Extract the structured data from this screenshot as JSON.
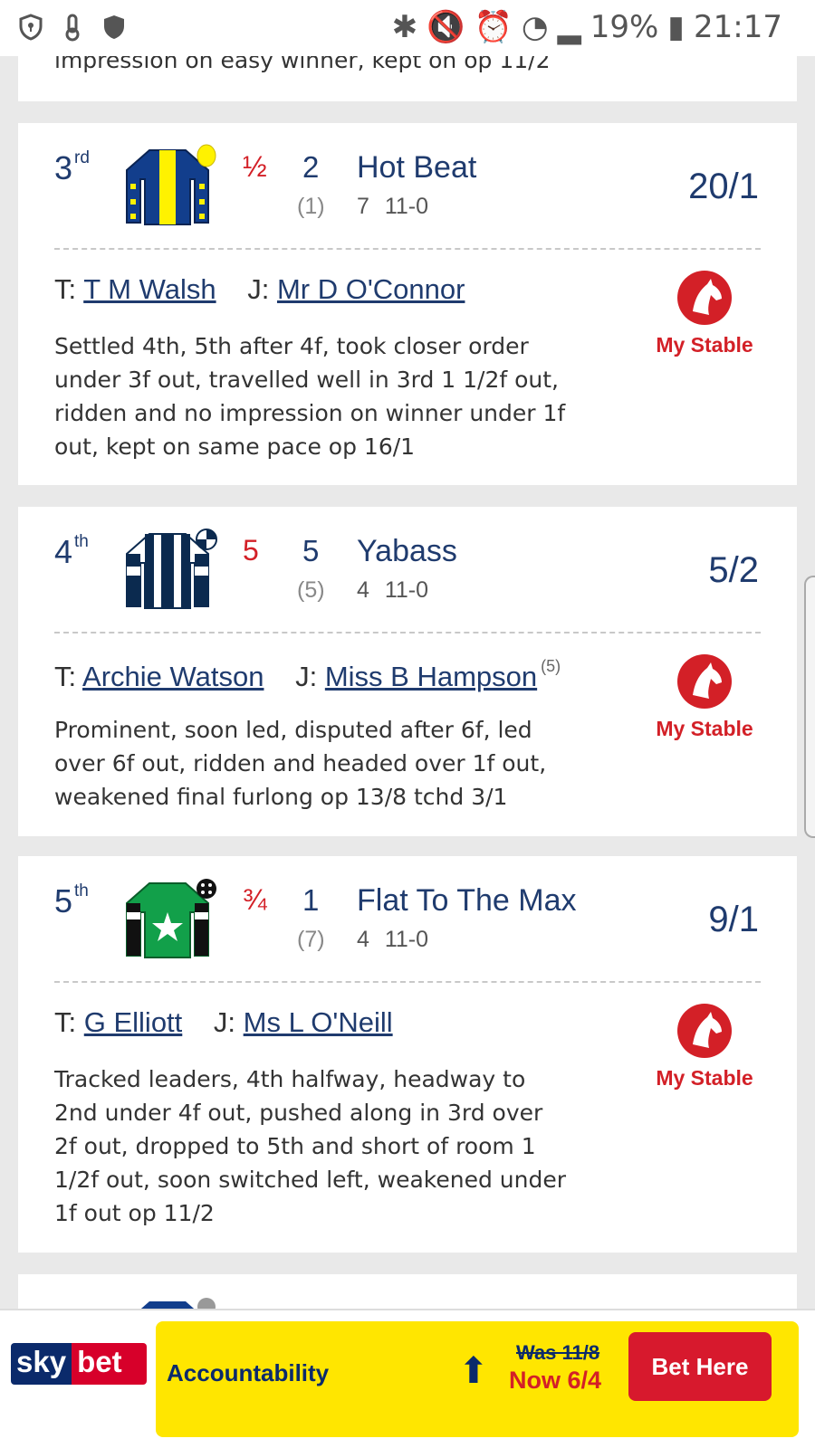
{
  "status_bar": {
    "battery": "19%",
    "time": "21:17",
    "left_icons": [
      "shield-icon",
      "thermometer-icon",
      "shield-filled-icon"
    ],
    "right_icons": [
      "bluetooth-icon",
      "mute-icon",
      "alarm-icon",
      "wifi-icon",
      "signal-icon",
      "battery-icon"
    ]
  },
  "top_card": {
    "analysis": "impression on easy winner, kept on op 11/2"
  },
  "runners": [
    {
      "position": "3",
      "position_suffix": "rd",
      "distance": "½",
      "number": "2",
      "draw": "(1)",
      "name": "Hot Beat",
      "age_weight": "7 11-0",
      "odds": "20/1",
      "trainer_prefix": "T:",
      "trainer": "T M Walsh",
      "jockey_prefix": "J:",
      "jockey": "Mr D O'Connor",
      "jockey_claim": "",
      "comment": "Settled 4th, 5th after 4f, took closer order under 3f out, travelled well in 3rd 1 1/2f out, ridden and no impression on winner under 1f out, kept on same pace op 16/1",
      "my_stable": "My Stable"
    },
    {
      "position": "4",
      "position_suffix": "th",
      "distance": "5",
      "number": "5",
      "draw": "(5)",
      "name": "Yabass",
      "age_weight": "4 11-0",
      "odds": "5/2",
      "trainer_prefix": "T:",
      "trainer": "Archie Watson",
      "jockey_prefix": "J:",
      "jockey": "Miss B Hampson",
      "jockey_claim": "(5)",
      "comment": "Prominent, soon led, disputed after 6f, led over 6f out, ridden and headed over 1f out, weakened final furlong op 13/8 tchd 3/1",
      "my_stable": "My Stable"
    },
    {
      "position": "5",
      "position_suffix": "th",
      "distance": "¾",
      "number": "1",
      "draw": "(7)",
      "name": "Flat To The Max",
      "age_weight": "4 11-0",
      "odds": "9/1",
      "trainer_prefix": "T:",
      "trainer": "G Elliott",
      "jockey_prefix": "J:",
      "jockey": "Ms L O'Neill",
      "jockey_claim": "",
      "comment": "Tracked leaders, 4th halfway, headway to 2nd under 4f out, pushed along in 3rd over 2f out, dropped to 5th and short of room 1 1/2f out, soon switched left, weakened under 1f out op 11/2",
      "my_stable": "My Stable"
    }
  ],
  "ad": {
    "brand_sky": "sky",
    "brand_bet": "bet",
    "horse": "Accountability",
    "was": "Was 11/8",
    "now": "Now 6/4",
    "button": "Bet Here",
    "colors": {
      "navy": "#0b2a6b",
      "red": "#d7192d",
      "yellow": "#ffe600"
    }
  },
  "colors": {
    "text_navy": "#1f3b6e",
    "accent_red": "#d32027",
    "background": "#e9e9e9"
  }
}
